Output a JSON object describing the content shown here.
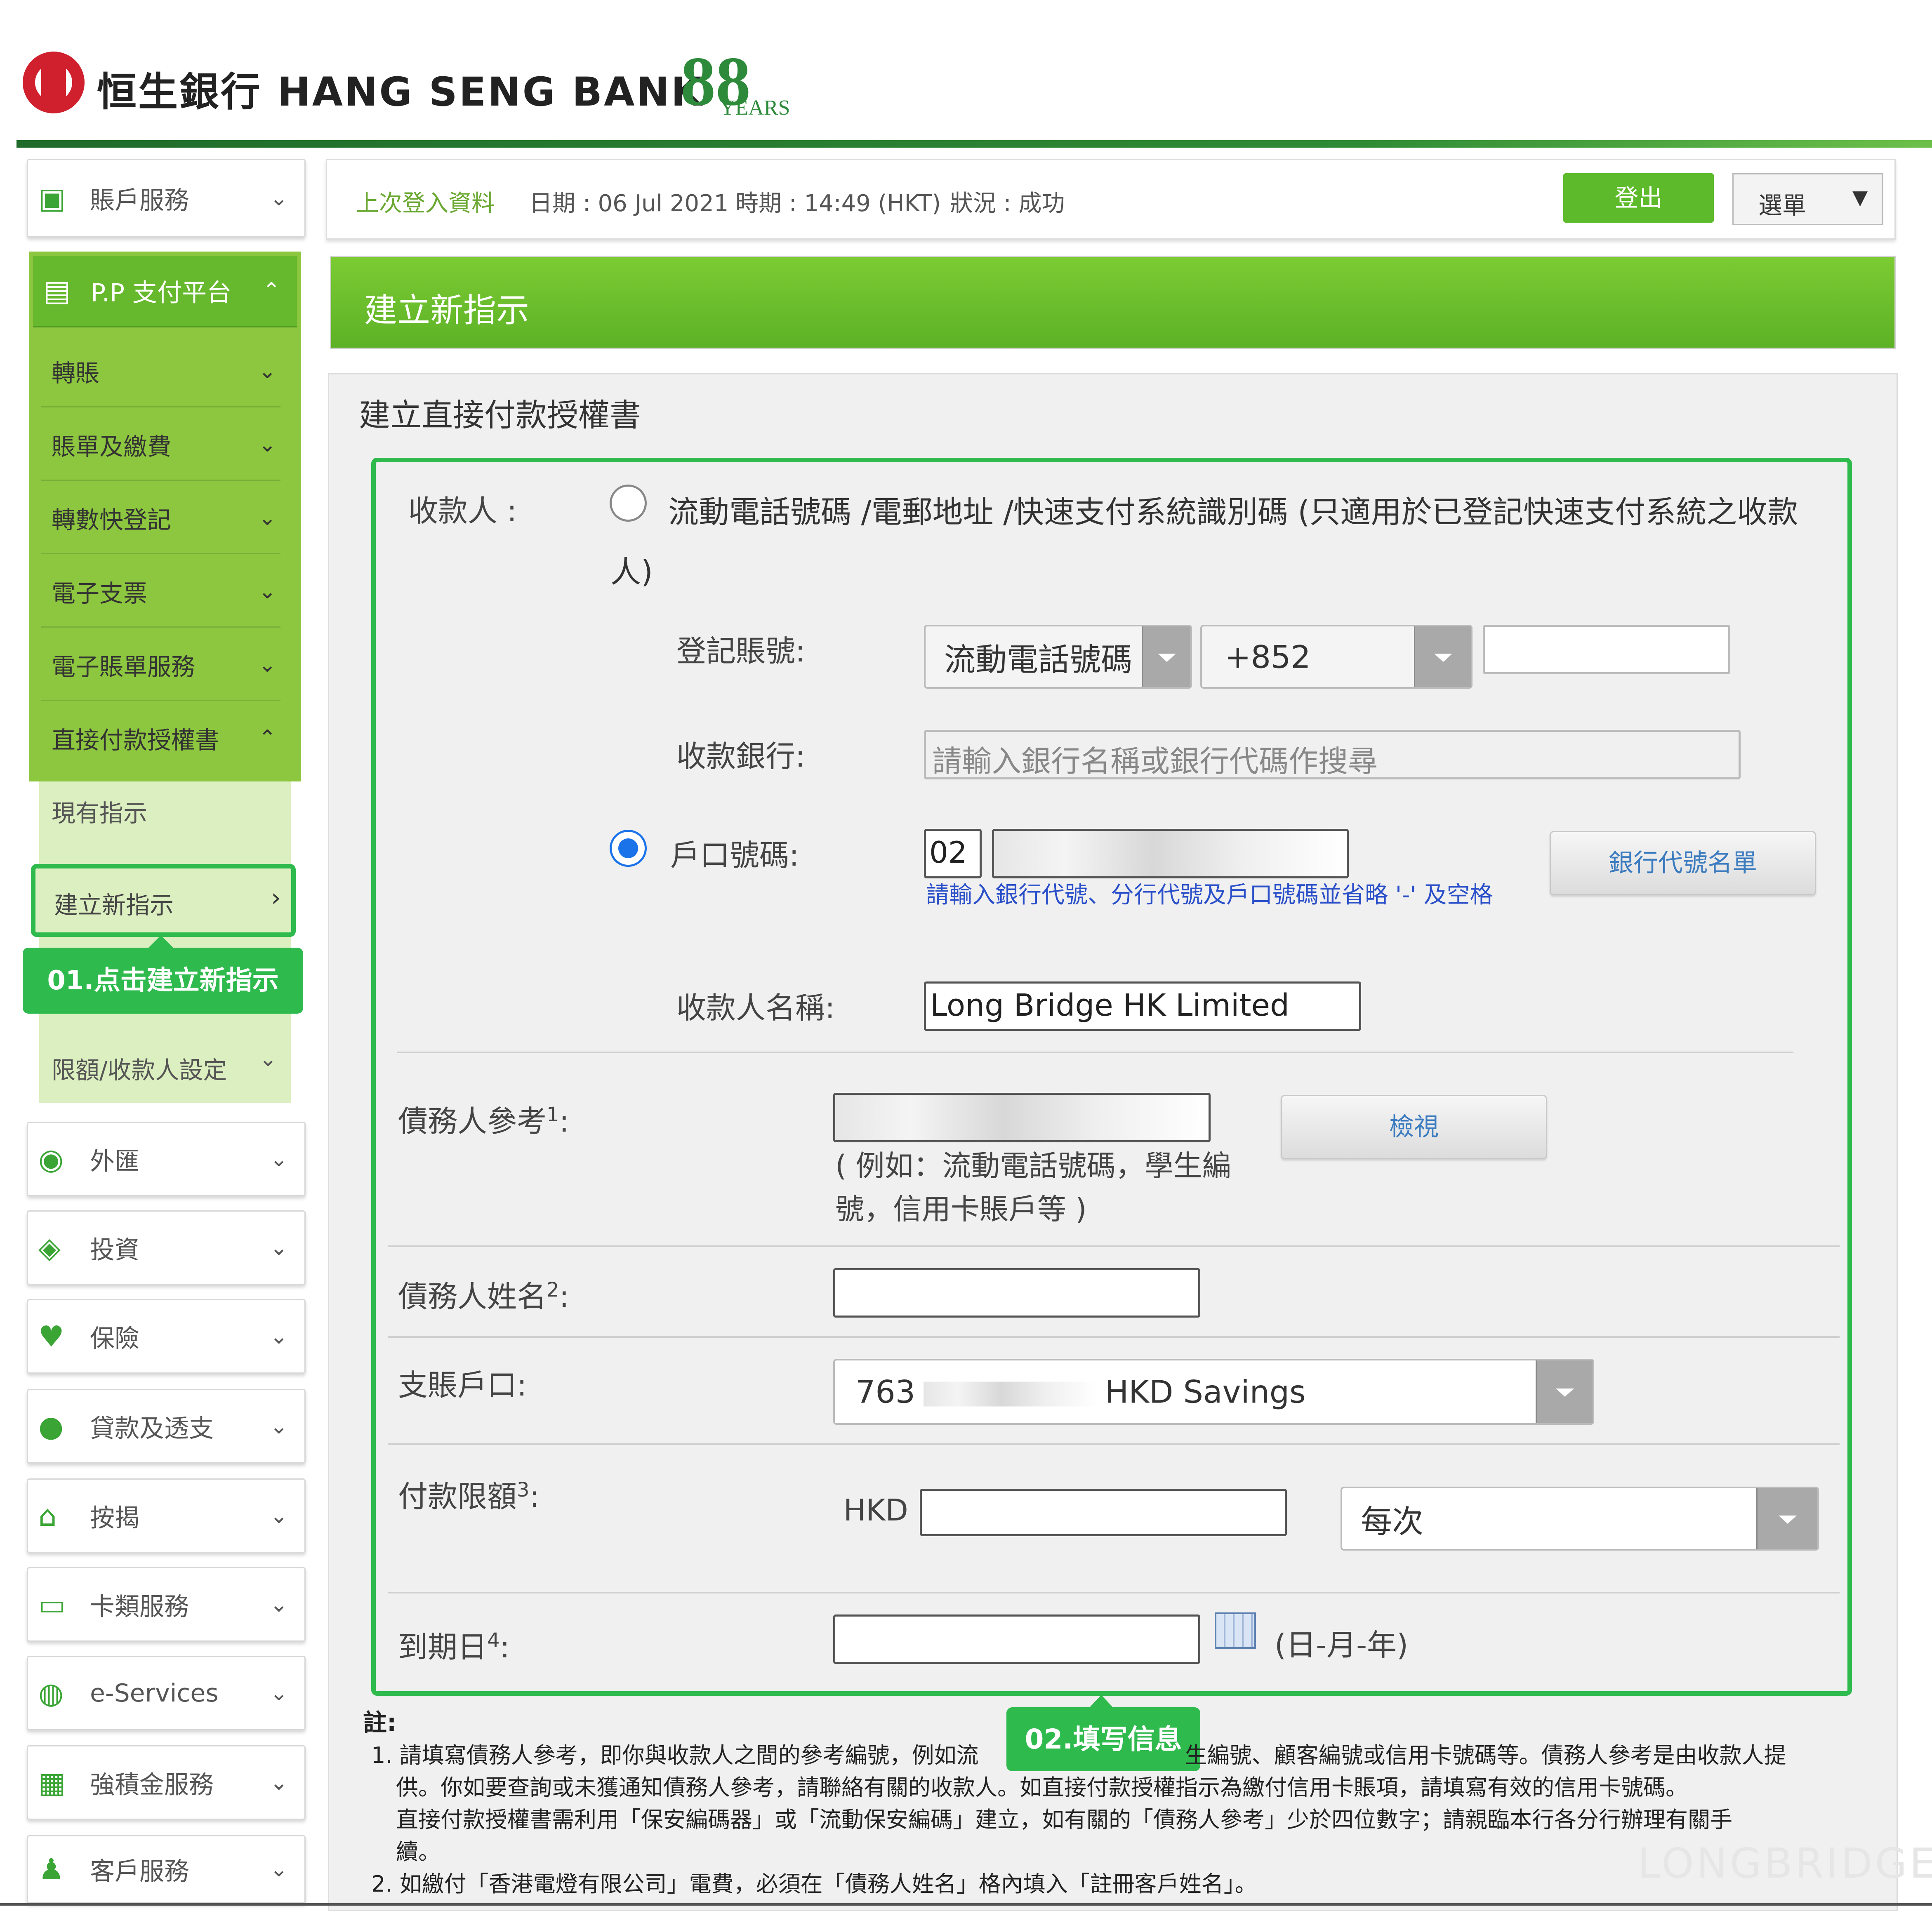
{
  "header": {
    "brand_name": "恒生銀行 HANG SENG BANK",
    "anniversary_number": "88",
    "anniversary_label": "YEARS"
  },
  "sidebar": {
    "top_item": {
      "label": "賬戶服務",
      "icon": "cash-icon"
    },
    "pp_header": {
      "label": "P.P 支付平台",
      "icon": "payment-icon"
    },
    "pp_items": [
      {
        "label": "轉賬"
      },
      {
        "label": "賬單及繳費"
      },
      {
        "label": "轉數快登記"
      },
      {
        "label": "電子支票"
      },
      {
        "label": "電子賬單服務"
      },
      {
        "label": "直接付款授權書"
      }
    ],
    "sub_items": [
      {
        "label": "現有指示"
      },
      {
        "label": "建立新指示"
      },
      {
        "label": "限額/收款人設定"
      }
    ],
    "items": [
      {
        "label": "外匯",
        "icon": "fx-icon"
      },
      {
        "label": "投資",
        "icon": "investment-icon"
      },
      {
        "label": "保險",
        "icon": "heart-icon"
      },
      {
        "label": "貸款及透支",
        "icon": "piggy-bank-icon"
      },
      {
        "label": "按揭",
        "icon": "house-icon"
      },
      {
        "label": "卡類服務",
        "icon": "card-icon"
      },
      {
        "label": "e-Services",
        "icon": "globe-icon"
      },
      {
        "label": "強積金服務",
        "icon": "mpf-icon"
      },
      {
        "label": "客戶服務",
        "icon": "customer-icon"
      }
    ]
  },
  "login_bar": {
    "last_login_label": "上次登入資料",
    "date": "日期 : 06 Jul 2021",
    "time": "時期 : 14:49 (HKT)",
    "status": "狀況 : 成功",
    "logout": "登出",
    "menu": "選單"
  },
  "page_title": "建立新指示",
  "form": {
    "title": "建立直接付款授權書",
    "payee_label": "收款人 :",
    "option_fps": "流動電話號碼 /電郵地址 /快速支付系統識別碼 (只適用於已登記快速支付系統之收款人)",
    "register_account_label": "登記賬號:",
    "register_type": "流動電話號碼",
    "country_code": "+852",
    "payee_bank_label": "收款銀行:",
    "payee_bank_placeholder": "請輸入銀行名稱或銀行代碼作搜尋",
    "option_account_label": "戶口號碼:",
    "bank_code_value": "02",
    "account_hint": "請輸入銀行代號、分行代號及戶口號碼並省略 '-' 及空格",
    "bank_code_list_button": "銀行代號名單",
    "payee_name_label": "收款人名稱:",
    "payee_name_value": "Long Bridge HK Limited",
    "debtor_ref_label": "債務人參考",
    "debtor_ref_sup": "1",
    "debtor_ref_hint": "( 例如：流動電話號碼，學生編號，信用卡賬戶等 )",
    "view_button": "檢視",
    "debtor_name_label": "債務人姓名",
    "debtor_name_sup": "2",
    "debit_account_label": "支賬戶口:",
    "debit_account_prefix": "763",
    "debit_account_suffix": "HKD Savings",
    "limit_label": "付款限額",
    "limit_sup": "3",
    "currency": "HKD",
    "frequency": "每次",
    "expiry_label": "到期日",
    "expiry_sup": "4",
    "date_format": "(日-月-年)"
  },
  "callouts": {
    "step1": "01.点击建立新指示",
    "step2": "02.填写信息"
  },
  "notes": {
    "heading": "註:",
    "note1_a": "1. 請填寫債務人參考，即你與收款人之間的參考編號，例如流",
    "note1_b": "生編號、顧客編號或信用卡號碼等。債務人參考是由收款人提",
    "note1_c": "供。你如要查詢或未獲通知債務人參考，請聯絡有關的收款人。如直接付款授權指示為繳付信用卡賬項，請填寫有效的信用卡號碼。",
    "note1_d": "直接付款授權書需利用「保安編碼器」或「流動保安編碼」建立，如有關的「債務人參考」少於四位數字；請親臨本行各分行辦理有關手",
    "note1_e": "續。",
    "note2": "2. 如繳付「香港電燈有限公司」電費，必須在「債務人姓名」格內填入「註冊客戶姓名」。"
  },
  "watermark": "LONGBRIDGE",
  "colors": {
    "brand_red": "#d0202e",
    "brand_green": "#5dbb2b",
    "highlight": "#2fba4e",
    "link_blue": "#3b7bbf"
  }
}
